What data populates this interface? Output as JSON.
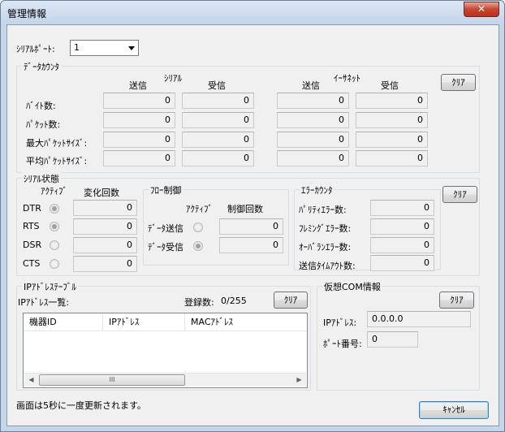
{
  "window": {
    "title": "管理情報",
    "close_glyph": "✕"
  },
  "serial_port": {
    "label": "ｼﾘｱﾙﾎﾟｰﾄ:",
    "value": "1"
  },
  "data_counter": {
    "title": "ﾃﾞｰﾀｶｳﾝﾀ",
    "serial_header": "ｼﾘｱﾙ",
    "ethernet_header": "ｲｰｻﾈｯﾄ",
    "send": "送信",
    "recv": "受信",
    "clear": "ｸﾘｱ",
    "rows": [
      {
        "label": "ﾊﾞｲﾄ数:",
        "serial_send": "0",
        "serial_recv": "0",
        "eth_send": "0",
        "eth_recv": "0"
      },
      {
        "label": "ﾊﾟｹｯﾄ数:",
        "serial_send": "0",
        "serial_recv": "0",
        "eth_send": "0",
        "eth_recv": "0"
      },
      {
        "label": "最大ﾊﾟｹｯﾄｻｲｽﾞ:",
        "serial_send": "0",
        "serial_recv": "0",
        "eth_send": "0",
        "eth_recv": "0"
      },
      {
        "label": "平均ﾊﾟｹｯﾄｻｲｽﾞ:",
        "serial_send": "0",
        "serial_recv": "0",
        "eth_send": "0",
        "eth_recv": "0"
      }
    ]
  },
  "serial_status": {
    "title": "ｼﾘｱﾙ状態",
    "active_header": "ｱｸﾃｨﾌﾞ",
    "count_header": "変化回数",
    "rows": [
      {
        "label": "DTR",
        "active": true,
        "count": "0"
      },
      {
        "label": "RTS",
        "active": true,
        "count": "0"
      },
      {
        "label": "DSR",
        "active": false,
        "count": "0"
      },
      {
        "label": "CTS",
        "active": false,
        "count": "0"
      }
    ]
  },
  "flow_control": {
    "title": "ﾌﾛｰ制御",
    "active_header": "ｱｸﾃｨﾌﾞ",
    "count_header": "制御回数",
    "rows": [
      {
        "label": "ﾃﾞｰﾀ送信",
        "active": false,
        "count": "0"
      },
      {
        "label": "ﾃﾞｰﾀ受信",
        "active": true,
        "count": "0"
      }
    ]
  },
  "error_counter": {
    "title": "ｴﾗｰｶｳﾝﾀ",
    "clear": "ｸﾘｱ",
    "rows": [
      {
        "label": "ﾊﾟﾘﾃｨｴﾗｰ数:",
        "value": "0"
      },
      {
        "label": "ﾌﾚﾐﾝｸﾞｴﾗｰ数:",
        "value": "0"
      },
      {
        "label": "ｵｰﾊﾞﾗﾝｴﾗｰ数:",
        "value": "0"
      },
      {
        "label": "送信ﾀｲﾑｱｳﾄ数:",
        "value": "0"
      }
    ]
  },
  "ip_table": {
    "title": "IPｱﾄﾞﾚｽﾃｰﾌﾞﾙ",
    "list_label": "IPｱﾄﾞﾚｽ一覧:",
    "registered_label": "登録数:",
    "registered_value": "0/255",
    "clear": "ｸﾘｱ",
    "columns": [
      "機器ID",
      "IPｱﾄﾞﾚｽ",
      "MACｱﾄﾞﾚｽ"
    ],
    "scroll_left": "◀",
    "scroll_right": "▶",
    "thumb_grip": "III"
  },
  "virtual_com": {
    "title": "仮想COM情報",
    "clear": "ｸﾘｱ",
    "ip_label": "IPｱﾄﾞﾚｽ:",
    "ip_value": "0.0.0.0",
    "port_label": "ﾎﾟｰﾄ番号:",
    "port_value": "0"
  },
  "footer": {
    "note": "画面は5秒に一度更新されます。",
    "cancel": "ｷｬﾝｾﾙ"
  }
}
